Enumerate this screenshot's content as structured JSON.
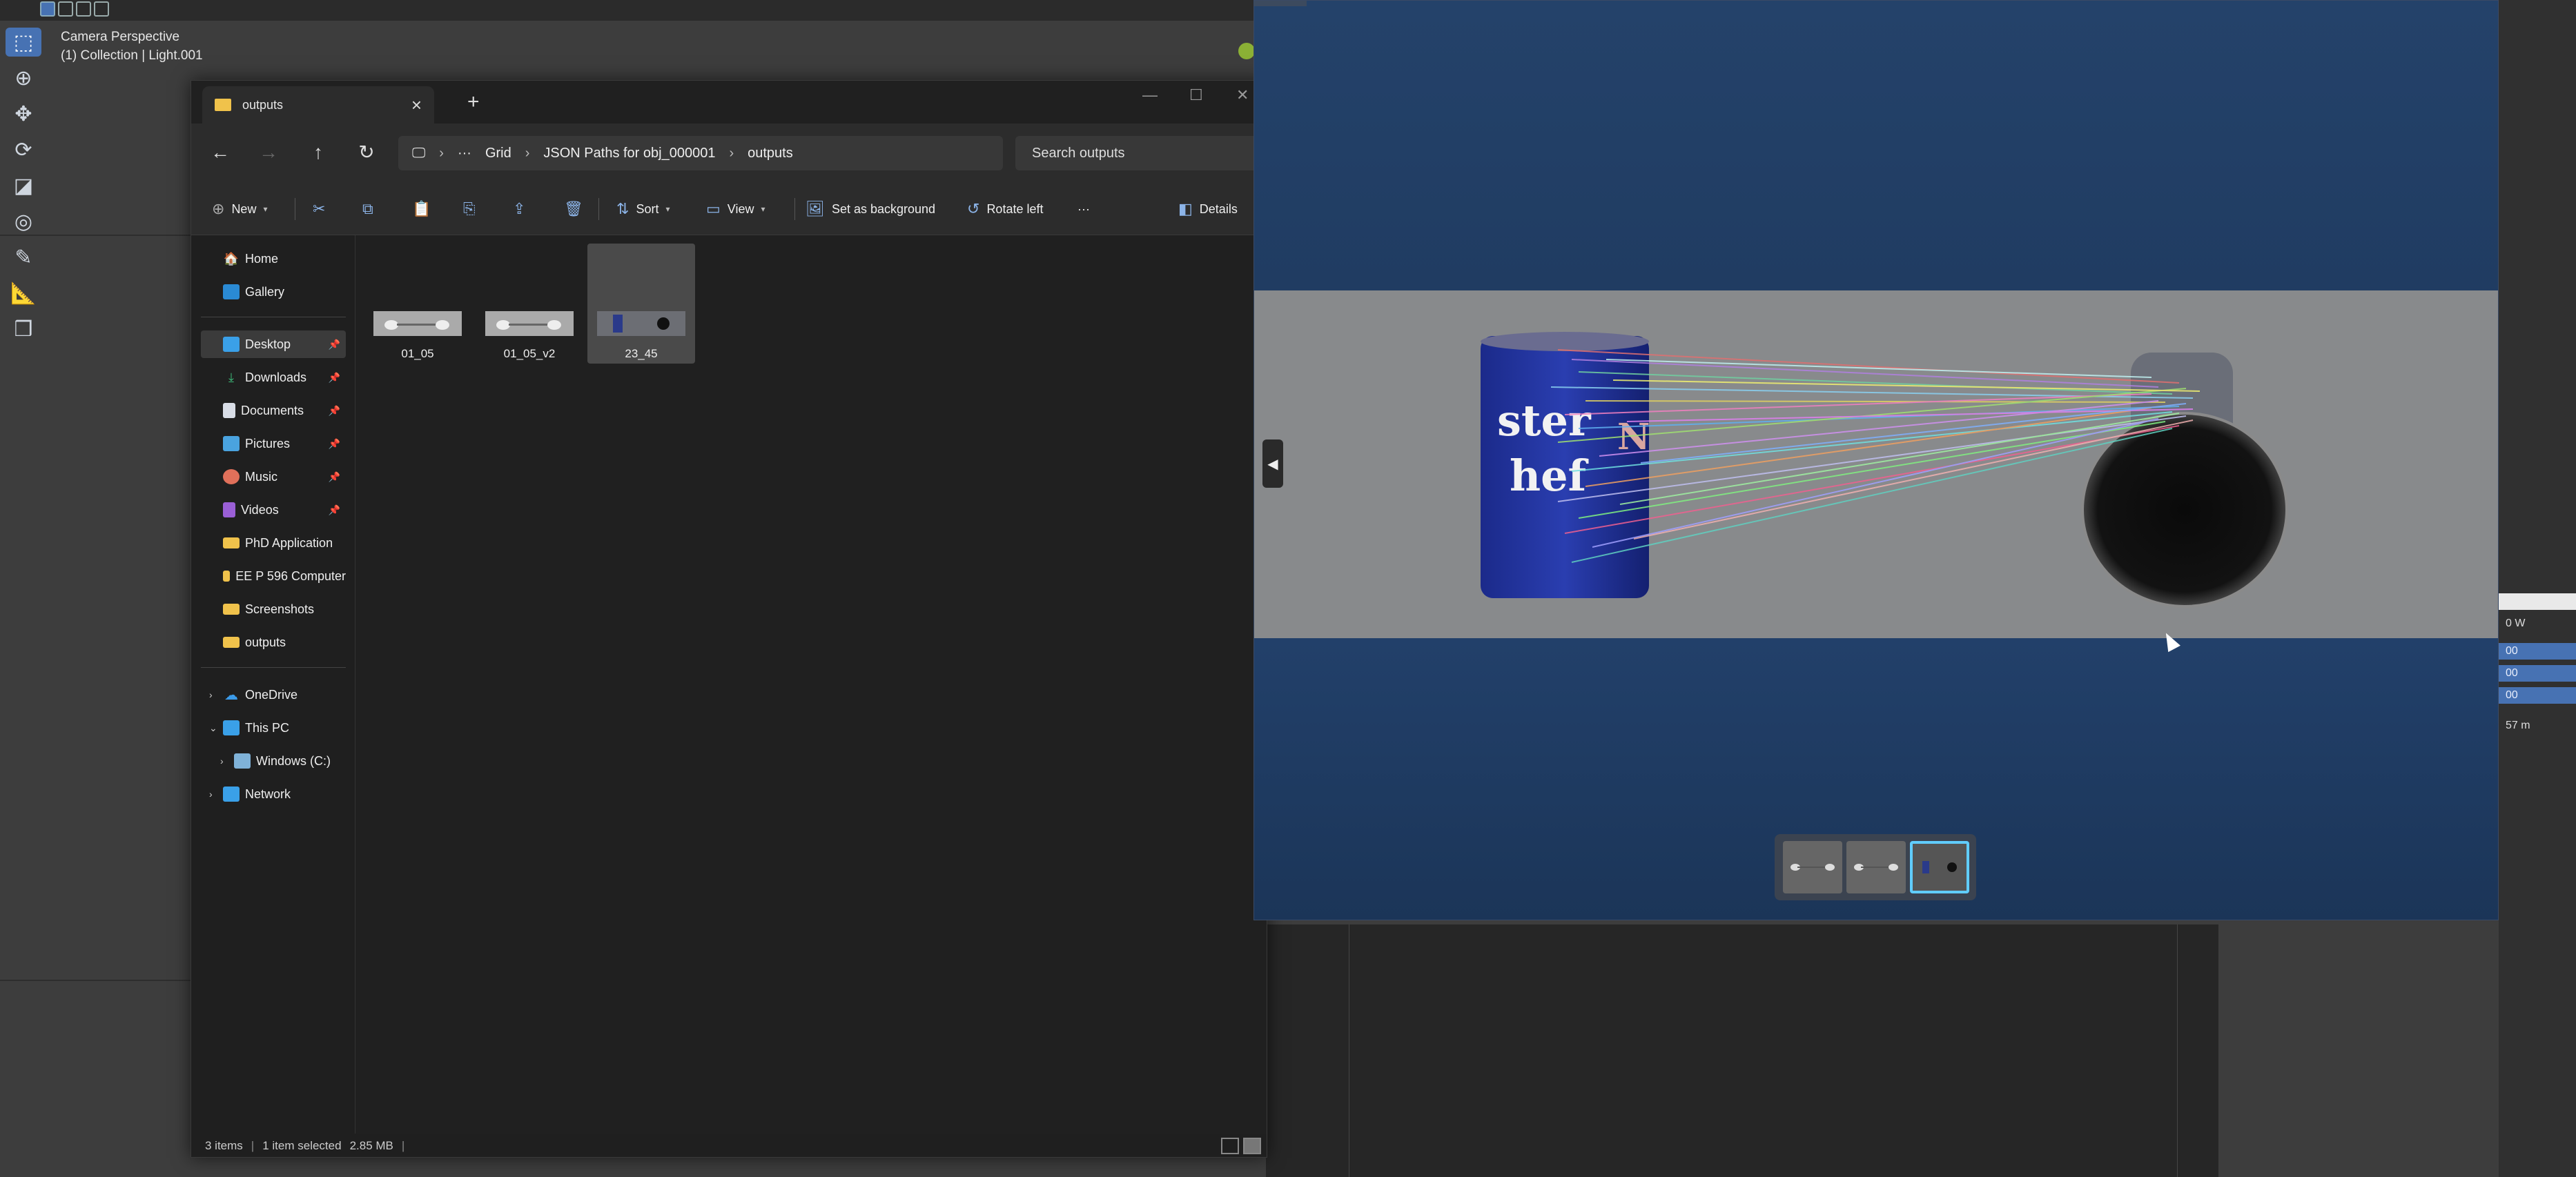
{
  "blender": {
    "viewport_title": "Camera Perspective",
    "viewport_collection": "(1) Collection | Light.001",
    "tools": [
      "select-box-icon",
      "cursor-icon",
      "move-icon",
      "rotate-icon",
      "scale-icon",
      "transform-icon",
      "annotate-icon",
      "measure-icon",
      "add-cube-icon"
    ],
    "side_values": [
      "0 W",
      "00",
      "00",
      "00",
      "57 m"
    ]
  },
  "explorer": {
    "tab_title": "outputs",
    "breadcrumb": [
      "Grid",
      "JSON Paths for obj_000001",
      "outputs"
    ],
    "breadcrumb_more": "···",
    "search_placeholder": "Search outputs",
    "commands": {
      "new": "New",
      "sort": "Sort",
      "view": "View",
      "set_background": "Set as background",
      "rotate_left": "Rotate left",
      "more": "···",
      "details": "Details"
    },
    "sidebar": {
      "home": "Home",
      "gallery": "Gallery",
      "desktop": "Desktop",
      "downloads": "Downloads",
      "documents": "Documents",
      "pictures": "Pictures",
      "music": "Music",
      "videos": "Videos",
      "phd": "PhD Application",
      "eep": "EE P 596 Computer",
      "screenshots": "Screenshots",
      "outputs": "outputs",
      "onedrive": "OneDrive",
      "thispc": "This PC",
      "windows": "Windows (C:)",
      "network": "Network"
    },
    "files": [
      "01_05",
      "01_05_v2",
      "23_45"
    ],
    "status": {
      "count": "3 items",
      "selected": "1 item selected",
      "size": "2.85 MB"
    }
  },
  "viewer": {
    "can_left_text": "ster",
    "can_left_text2": "hef",
    "can_mid_text": "N"
  }
}
